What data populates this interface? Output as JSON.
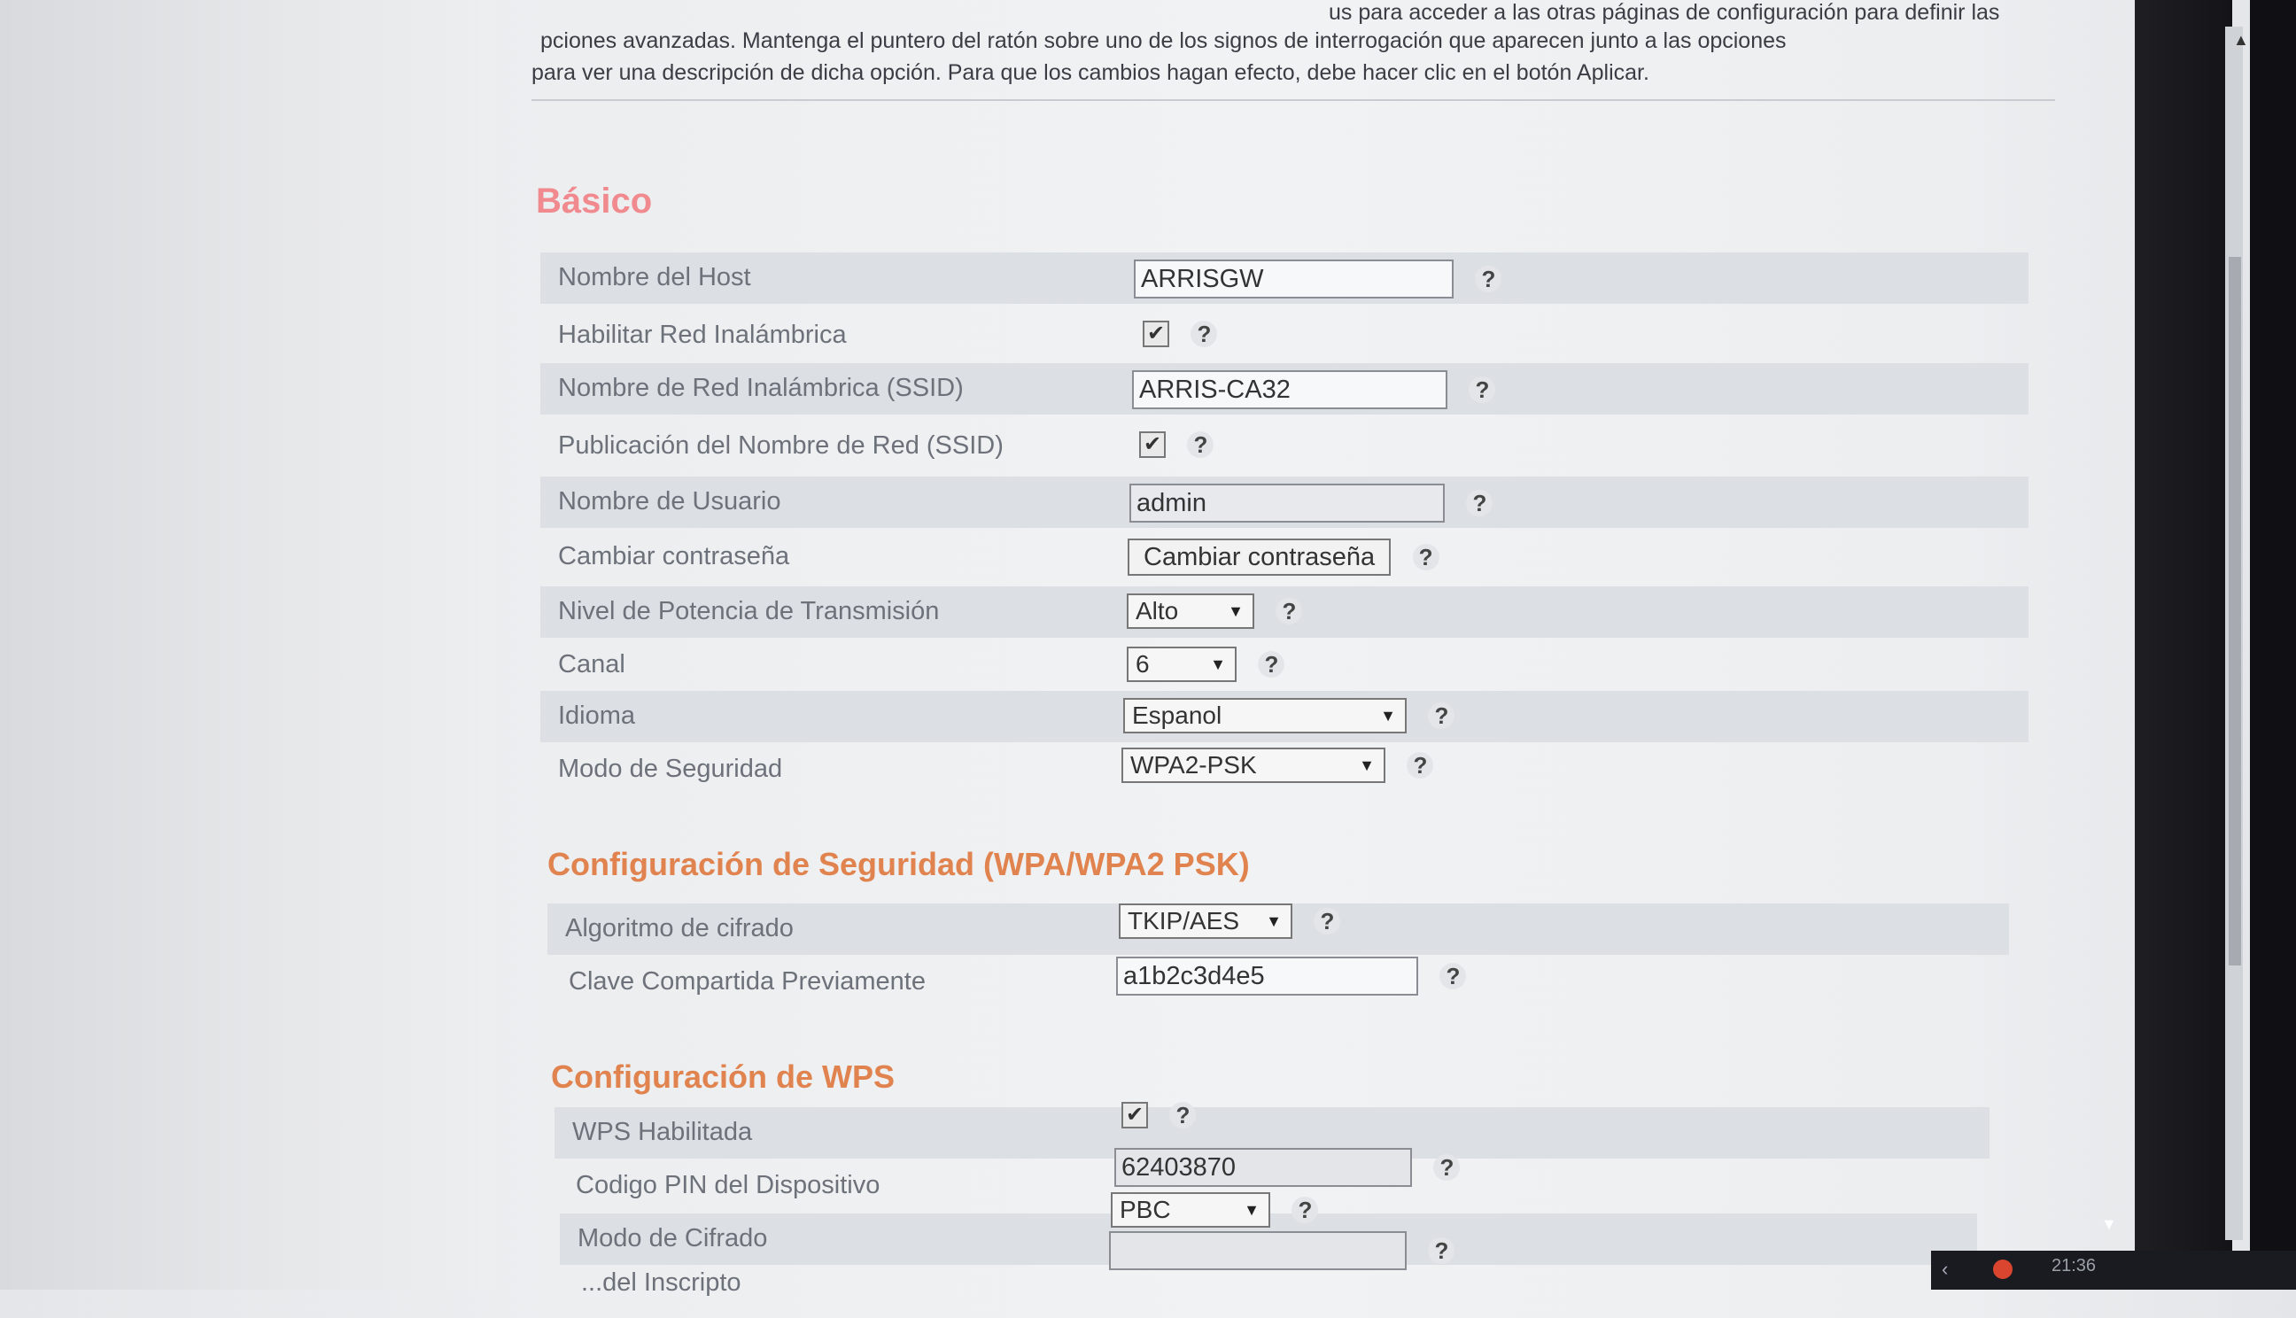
{
  "intro": {
    "line1": "pciones avanzadas. Mantenga el puntero del ratón sobre uno de los signos de interrogación que aparecen junto a las opciones",
    "line0": "us para acceder a las otras páginas de configuración para definir las",
    "line2": "para ver una descripción de dicha opción. Para que los cambios hagan efecto, debe hacer clic en el botón Aplicar."
  },
  "help_symbol": "?",
  "sections": {
    "basic": "Básico",
    "security": "Configuración de Seguridad (WPA/WPA2 PSK)",
    "wps": "Configuración de WPS"
  },
  "basic": {
    "hostname_label": "Nombre del Host",
    "hostname_value": "ARRISGW",
    "wireless_label": "Habilitar Red Inalámbrica",
    "wireless_checked": true,
    "ssid_label": "Nombre de Red Inalámbrica (SSID)",
    "ssid_value": "ARRIS-CA32",
    "broadcast_label": "Publicación del Nombre de Red (SSID)",
    "broadcast_checked": true,
    "username_label": "Nombre de Usuario",
    "username_value": "admin",
    "password_label": "Cambiar contraseña",
    "password_button": "Cambiar contraseña",
    "power_label": "Nivel de Potencia de Transmisión",
    "power_value": "Alto",
    "channel_label": "Canal",
    "channel_value": "6",
    "language_label": "Idioma",
    "language_value": "Espanol",
    "secmode_label": "Modo de Seguridad",
    "secmode_value": "WPA2-PSK"
  },
  "security": {
    "cipher_label": "Algoritmo de cifrado",
    "cipher_value": "TKIP/AES",
    "psk_label": "Clave Compartida Previamente",
    "psk_value": "a1b2c3d4e5"
  },
  "wps": {
    "enabled_label": "WPS Habilitada",
    "enabled_checked": true,
    "pin_label": "Codigo PIN del Dispositivo",
    "pin_value": "62403870",
    "mode_label": "Modo de Cifrado",
    "mode_value": "PBC",
    "enroll_label": "...del Inscripto",
    "enroll_value": ""
  },
  "taskbar": {
    "clock": "21:36"
  },
  "glyphs": {
    "check": "✔",
    "arrow": "▼",
    "scroll_up": "▲",
    "scroll_down": "▼"
  }
}
